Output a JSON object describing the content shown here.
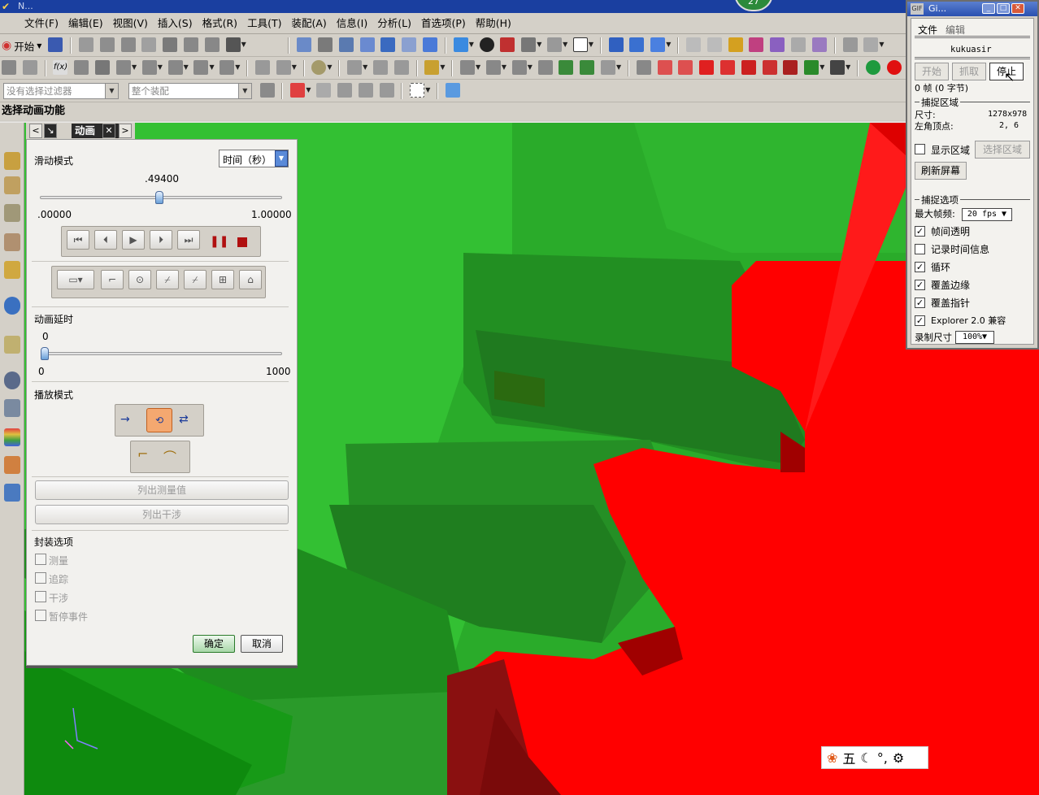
{
  "window": {
    "title": "N...",
    "timer_badge": "27"
  },
  "menubar": {
    "items": [
      "文件(F)",
      "编辑(E)",
      "视图(V)",
      "插入(S)",
      "格式(R)",
      "工具(T)",
      "装配(A)",
      "信息(I)",
      "分析(L)",
      "首选项(P)",
      "帮助(H)"
    ]
  },
  "toolbar": {
    "start_label": "开始",
    "filter_placeholder": "没有选择过滤器",
    "scope_value": "整个装配"
  },
  "status_line": "选择动画功能",
  "dialog": {
    "tab_title": "动画",
    "slide_mode_label": "滑动模式",
    "slide_mode_value": "时间（秒）",
    "slider_value": ".49400",
    "slider_min": ".00000",
    "slider_max": "1.00000",
    "slider_fraction": 0.494,
    "delay_label": "动画延时",
    "delay_value": "0",
    "delay_min": "0",
    "delay_max": "1000",
    "playback_label": "播放模式",
    "list_measure": "列出测量值",
    "list_interference": "列出干涉",
    "package_label": "封装选项",
    "package_options": [
      "测量",
      "追踪",
      "干涉",
      "暂停事件"
    ],
    "ok": "确定",
    "cancel": "取消"
  },
  "recorder": {
    "title": "Gi...",
    "menu_file": "文件",
    "menu_edit": "编辑",
    "author": "kukuasir",
    "btn_start": "开始",
    "btn_capture": "抓取",
    "btn_stop": "停止",
    "frames_info": "0 帧 (0 字节)",
    "capture_area_header": "捕捉区域",
    "size_label": "尺寸:",
    "size_value": "1278x978",
    "corner_label": "左角顶点:",
    "corner_value": "2, 6",
    "show_area": "显示区域",
    "select_area": "选择区域",
    "refresh_screen": "刷新屏幕",
    "capture_options_header": "捕捉选项",
    "max_fps_label": "最大帧频:",
    "max_fps_value": "20 fps",
    "options": [
      {
        "label": "帧间透明",
        "checked": true
      },
      {
        "label": "记录时间信息",
        "checked": false
      },
      {
        "label": "循环",
        "checked": true
      },
      {
        "label": "覆盖边缘",
        "checked": true
      },
      {
        "label": "覆盖指针",
        "checked": true
      },
      {
        "label": "Explorer 2.0 兼容",
        "checked": true
      }
    ],
    "rec_size_label": "录制尺寸",
    "rec_size_value": "100%"
  },
  "ime": {
    "mode_char": "五"
  },
  "colors": {
    "gear_green": "#2ec02e",
    "gear_dark_green": "#1f8a1f",
    "gear_red": "#ff0000",
    "titlebar": "#1a3fa0"
  }
}
